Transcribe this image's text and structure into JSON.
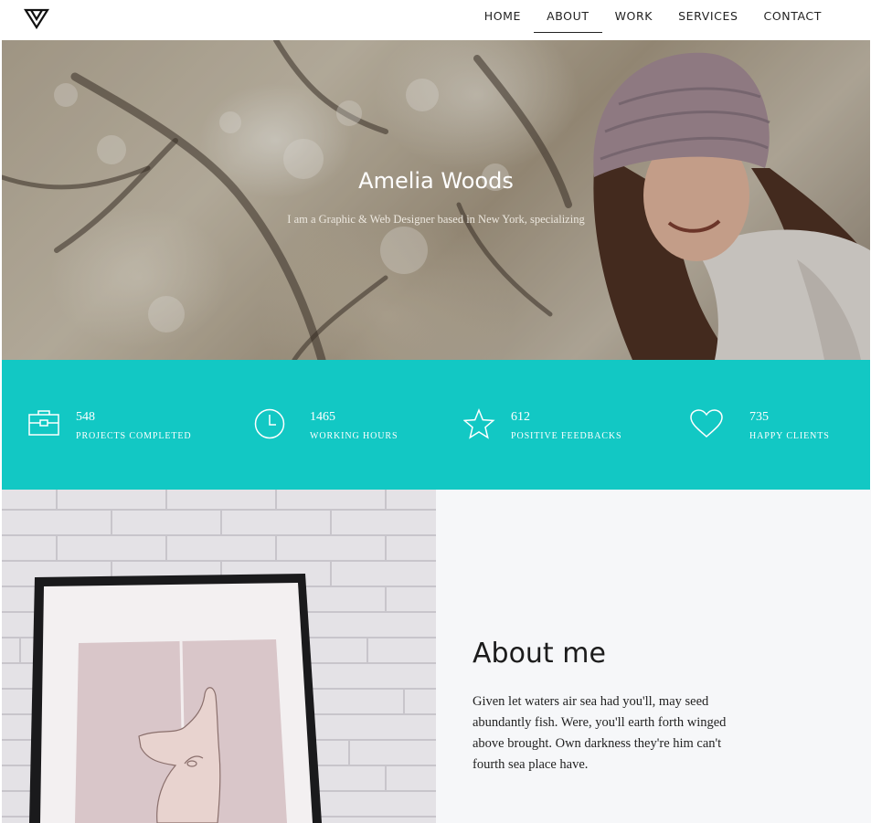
{
  "header": {
    "logo_icon": "triangle-logo-icon",
    "nav": [
      {
        "label": "HOME",
        "active": false
      },
      {
        "label": "ABOUT",
        "active": true
      },
      {
        "label": "WORK",
        "active": false
      },
      {
        "label": "SERVICES",
        "active": false
      },
      {
        "label": "CONTACT",
        "active": false
      }
    ]
  },
  "hero": {
    "title": "Amelia Woods",
    "subtitle": "I am a Graphic & Web Designer based in New York, specializing"
  },
  "stats": {
    "background_color": "#12c8c4",
    "items": [
      {
        "icon": "briefcase-icon",
        "value": "548",
        "label": "PROJECTS COMPLETED"
      },
      {
        "icon": "clock-icon",
        "value": "1465",
        "label": "WORKING HOURS"
      },
      {
        "icon": "star-icon",
        "value": "612",
        "label": "POSITIVE FEEDBACKS"
      },
      {
        "icon": "heart-icon",
        "value": "735",
        "label": "HAPPY CLIENTS"
      }
    ]
  },
  "about": {
    "title": "About me",
    "body": "Given let waters air sea had you'll, may seed abundantly fish. Were, you'll earth forth winged above brought. Own darkness they're him can't fourth sea place have."
  }
}
